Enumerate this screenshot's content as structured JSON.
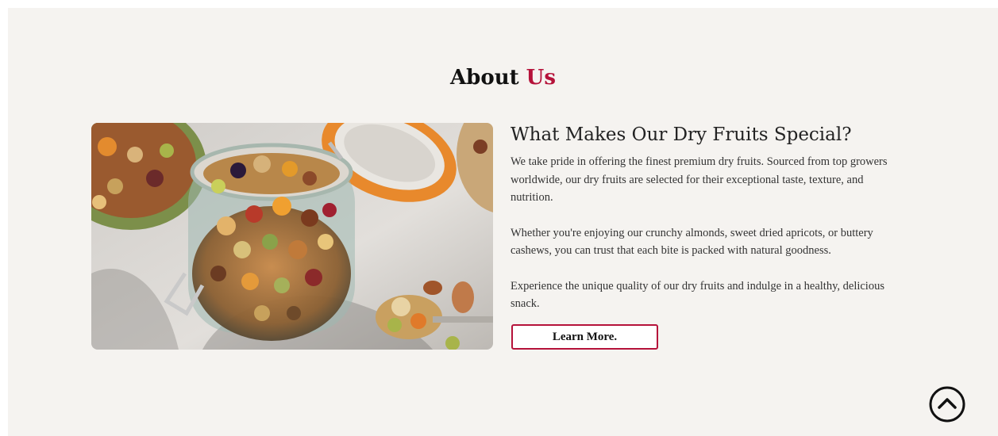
{
  "about": {
    "title_main": "About",
    "title_accent": "Us",
    "heading": "What Makes Our Dry Fruits Special?",
    "paragraphs": [
      "We take pride in offering the finest premium dry fruits. Sourced from top growers worldwide, our dry fruits are selected for their exceptional taste, texture, and nutrition.",
      "Whether you're enjoying our crunchy almonds, sweet dried apricots, or buttery cashews, you can trust that each bite is packed with natural goodness.",
      "Experience the unique quality of our dry fruits and indulge in a healthy, delicious snack."
    ],
    "button_label": "Learn More."
  },
  "icons": {
    "scroll_top": "chevron-up-circle-icon"
  },
  "colors": {
    "accent": "#b5123a",
    "background": "#f5f3f0",
    "text": "#333333"
  }
}
